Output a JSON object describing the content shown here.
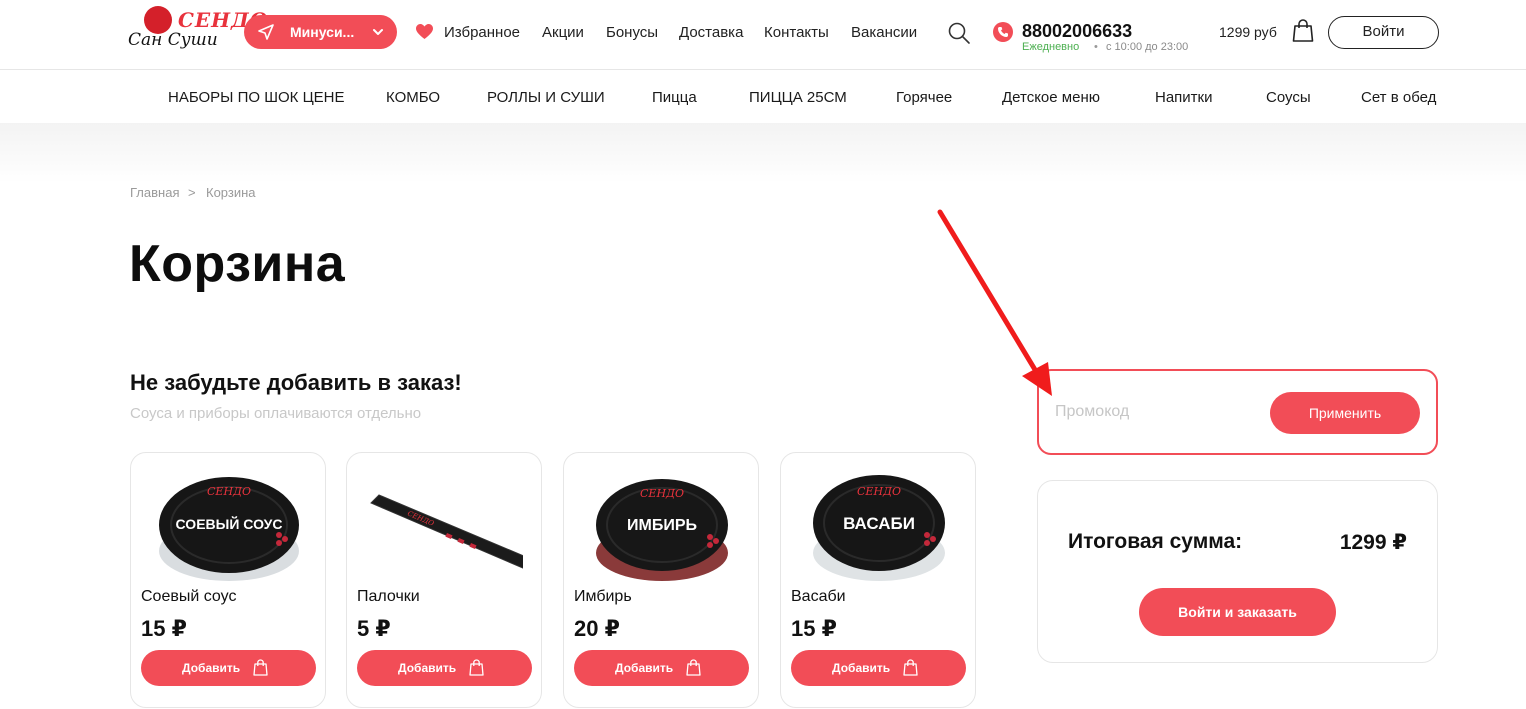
{
  "header": {
    "logo": {
      "top_text": "СЕНДО",
      "bottom_text": "Сан Суши"
    },
    "city_selector": {
      "label": "Минуси..."
    },
    "nav": [
      {
        "label": "Избранное"
      },
      {
        "label": "Акции"
      },
      {
        "label": "Бонусы"
      },
      {
        "label": "Доставка"
      },
      {
        "label": "Контакты"
      },
      {
        "label": "Вакансии"
      }
    ],
    "phone": "88002006633",
    "hours": {
      "days": "Ежедневно",
      "separator": "•",
      "time": "с 10:00 до 23:00"
    },
    "cart_sum": "1299 руб",
    "login_label": "Войти"
  },
  "categories": [
    {
      "label": "НАБОРЫ ПО ШОК ЦЕНЕ"
    },
    {
      "label": "КОМБО"
    },
    {
      "label": "РОЛЛЫ И СУШИ"
    },
    {
      "label": "Пицца"
    },
    {
      "label": "ПИЦЦА 25СМ"
    },
    {
      "label": "Горячее"
    },
    {
      "label": "Детское меню"
    },
    {
      "label": "Напитки"
    },
    {
      "label": "Соусы"
    },
    {
      "label": "Сет в обед"
    }
  ],
  "breadcrumb": {
    "home": "Главная",
    "separator": ">",
    "current": "Корзина"
  },
  "page_title": "Корзина",
  "upsell": {
    "title": "Не забудьте добавить в заказ!",
    "subtitle": "Соуса и приборы оплачиваются отдельно",
    "add_label": "Добавить",
    "products": [
      {
        "name": "Соевый соус",
        "price": "15 ₽",
        "lid_text": "СОЕВЫЙ СОУС",
        "kind": "container"
      },
      {
        "name": "Палочки",
        "price": "5 ₽",
        "lid_text": "",
        "kind": "chopsticks"
      },
      {
        "name": "Имбирь",
        "price": "20 ₽",
        "lid_text": "ИМБИРЬ",
        "kind": "container"
      },
      {
        "name": "Васаби",
        "price": "15 ₽",
        "lid_text": "ВАСАБИ",
        "kind": "container"
      }
    ]
  },
  "promo": {
    "placeholder": "Промокод",
    "apply_label": "Применить"
  },
  "summary": {
    "total_label": "Итоговая сумма:",
    "total_value": "1299 ₽",
    "order_label": "Войти и заказать"
  },
  "colors": {
    "accent": "#f24d57",
    "text": "#111111",
    "muted": "#9a9a9a",
    "hours_green": "#4caf50"
  }
}
